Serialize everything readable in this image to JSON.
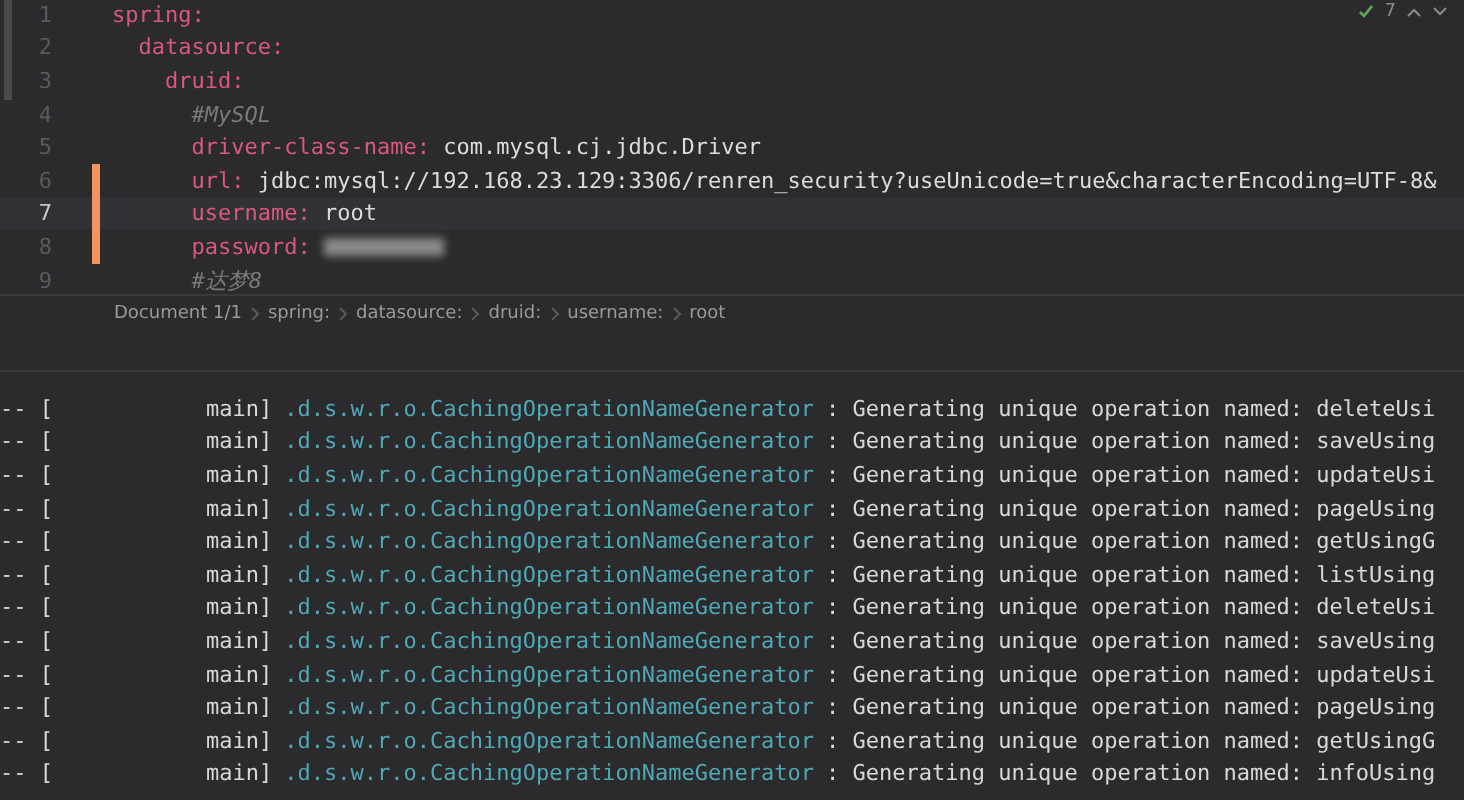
{
  "editor": {
    "inspection": {
      "count": "7"
    },
    "lines": [
      {
        "number": "1",
        "kind": "key",
        "key": "spring:",
        "modified": false,
        "current": false,
        "children": [
          {
            "number": "2",
            "kind": "key",
            "key": "datasource:",
            "modified": false,
            "current": false,
            "children": [
              {
                "number": "3",
                "kind": "key",
                "key": "druid:",
                "modified": false,
                "current": false,
                "children": [
                  {
                    "number": "4",
                    "kind": "comment",
                    "text": "#MySQL",
                    "modified": false,
                    "current": false
                  },
                  {
                    "number": "5",
                    "kind": "key",
                    "key": "driver-class-name:",
                    "value": "com.mysql.cj.jdbc.Driver",
                    "modified": false,
                    "current": false
                  },
                  {
                    "number": "6",
                    "kind": "key",
                    "key": "url:",
                    "value": "jdbc:mysql://192.168.23.129:3306/renren_security?useUnicode=true&characterEncoding=UTF-8&",
                    "modified": true,
                    "current": false
                  },
                  {
                    "number": "7",
                    "kind": "key",
                    "key": "username:",
                    "value": "root",
                    "modified": true,
                    "current": true
                  },
                  {
                    "number": "8",
                    "kind": "redacted",
                    "key": "password:",
                    "modified": true,
                    "current": false
                  },
                  {
                    "number": "9",
                    "kind": "comment",
                    "text": "#达梦8",
                    "modified": false,
                    "current": false
                  }
                ]
              }
            ]
          }
        ]
      }
    ],
    "breadcrumbs": [
      "Document 1/1",
      "spring:",
      "datasource:",
      "druid:",
      "username:",
      "root"
    ]
  },
  "console": {
    "rows": [
      {
        "prefix": "-- [",
        "thread": "main]",
        "logger": ".d.s.w.r.o.CachingOperationNameGenerator",
        "message": ": Generating unique operation named: deleteUsi"
      },
      {
        "prefix": "-- [",
        "thread": "main]",
        "logger": ".d.s.w.r.o.CachingOperationNameGenerator",
        "message": ": Generating unique operation named: saveUsing"
      },
      {
        "prefix": "-- [",
        "thread": "main]",
        "logger": ".d.s.w.r.o.CachingOperationNameGenerator",
        "message": ": Generating unique operation named: updateUsi"
      },
      {
        "prefix": "-- [",
        "thread": "main]",
        "logger": ".d.s.w.r.o.CachingOperationNameGenerator",
        "message": ": Generating unique operation named: pageUsing"
      },
      {
        "prefix": "-- [",
        "thread": "main]",
        "logger": ".d.s.w.r.o.CachingOperationNameGenerator",
        "message": ": Generating unique operation named: getUsingG"
      },
      {
        "prefix": "-- [",
        "thread": "main]",
        "logger": ".d.s.w.r.o.CachingOperationNameGenerator",
        "message": ": Generating unique operation named: listUsing"
      },
      {
        "prefix": "-- [",
        "thread": "main]",
        "logger": ".d.s.w.r.o.CachingOperationNameGenerator",
        "message": ": Generating unique operation named: deleteUsi"
      },
      {
        "prefix": "-- [",
        "thread": "main]",
        "logger": ".d.s.w.r.o.CachingOperationNameGenerator",
        "message": ": Generating unique operation named: saveUsing"
      },
      {
        "prefix": "-- [",
        "thread": "main]",
        "logger": ".d.s.w.r.o.CachingOperationNameGenerator",
        "message": ": Generating unique operation named: updateUsi"
      },
      {
        "prefix": "-- [",
        "thread": "main]",
        "logger": ".d.s.w.r.o.CachingOperationNameGenerator",
        "message": ": Generating unique operation named: pageUsing"
      },
      {
        "prefix": "-- [",
        "thread": "main]",
        "logger": ".d.s.w.r.o.CachingOperationNameGenerator",
        "message": ": Generating unique operation named: getUsingG"
      },
      {
        "prefix": "-- [",
        "thread": "main]",
        "logger": ".d.s.w.r.o.CachingOperationNameGenerator",
        "message": ": Generating unique operation named: infoUsing"
      }
    ]
  }
}
